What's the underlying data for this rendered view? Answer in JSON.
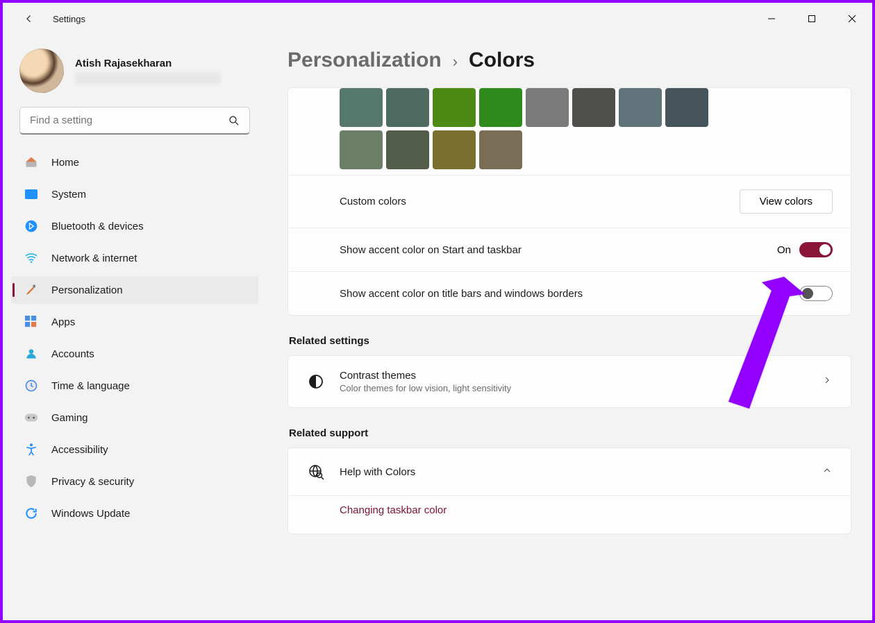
{
  "app": {
    "title": "Settings"
  },
  "user": {
    "name": "Atish Rajasekharan"
  },
  "search": {
    "placeholder": "Find a setting"
  },
  "nav": {
    "items": [
      {
        "id": "home",
        "label": "Home"
      },
      {
        "id": "system",
        "label": "System"
      },
      {
        "id": "bluetooth",
        "label": "Bluetooth & devices"
      },
      {
        "id": "network",
        "label": "Network & internet"
      },
      {
        "id": "personalization",
        "label": "Personalization",
        "active": true
      },
      {
        "id": "apps",
        "label": "Apps"
      },
      {
        "id": "accounts",
        "label": "Accounts"
      },
      {
        "id": "time",
        "label": "Time & language"
      },
      {
        "id": "gaming",
        "label": "Gaming"
      },
      {
        "id": "accessibility",
        "label": "Accessibility"
      },
      {
        "id": "privacy",
        "label": "Privacy & security"
      },
      {
        "id": "update",
        "label": "Windows Update"
      }
    ]
  },
  "breadcrumb": {
    "parent": "Personalization",
    "sep": "›",
    "current": "Colors"
  },
  "colors": {
    "swatches": [
      "#56786d",
      "#4e6b61",
      "#4c8a14",
      "#2e8b1c",
      "#7a7a7a",
      "#4f4f4c",
      "#60727a",
      "#45555b",
      "#6b8066",
      "#525c48",
      "#7a6f2f",
      "#7a6d55"
    ],
    "custom_label": "Custom colors",
    "view_btn": "View colors",
    "accent_start_label": "Show accent color on Start and taskbar",
    "accent_start_state": "On",
    "accent_title_label": "Show accent color on title bars and windows borders"
  },
  "related_settings": {
    "heading": "Related settings",
    "contrast_title": "Contrast themes",
    "contrast_sub": "Color themes for low vision, light sensitivity"
  },
  "related_support": {
    "heading": "Related support",
    "help_title": "Help with Colors",
    "link1": "Changing taskbar color"
  }
}
